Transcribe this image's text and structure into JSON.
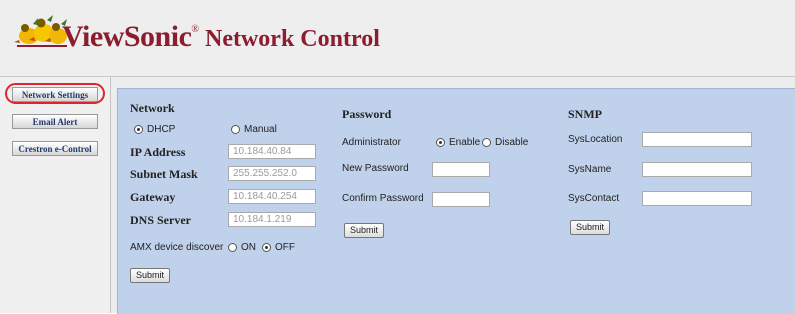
{
  "brand": {
    "name": "ViewSonic",
    "registered": "®",
    "product": "Network Control"
  },
  "sidebar": {
    "items": [
      {
        "label": "Network Settings",
        "active": true
      },
      {
        "label": "Email Alert"
      },
      {
        "label": "Crestron e-Control"
      }
    ]
  },
  "network": {
    "heading": "Network",
    "dhcp_label": "DHCP",
    "manual_label": "Manual",
    "mode_selected": "DHCP",
    "ip_label": "IP Address",
    "ip_value": "10.184.40.84",
    "mask_label": "Subnet Mask",
    "mask_value": "255.255.252.0",
    "gateway_label": "Gateway",
    "gateway_value": "10.184.40.254",
    "dns_label": "DNS Server",
    "dns_value": "10.184.1.219",
    "amx_label": "AMX device discover",
    "on_label": "ON",
    "off_label": "OFF",
    "amx_selected": "OFF",
    "submit_label": "Submit"
  },
  "password": {
    "heading": "Password",
    "admin_label": "Administrator",
    "enable_label": "Enable",
    "disable_label": "Disable",
    "admin_selected": "Enable",
    "new_label": "New Password",
    "new_value": "",
    "confirm_label": "Confirm Password",
    "confirm_value": "",
    "submit_label": "Submit"
  },
  "snmp": {
    "heading": "SNMP",
    "location_label": "SysLocation",
    "location_value": "",
    "name_label": "SysName",
    "name_value": "",
    "contact_label": "SysContact",
    "contact_value": "",
    "submit_label": "Submit"
  },
  "colors": {
    "brand": "#8c1d2e",
    "panel": "#c0d2eb",
    "highlight": "#e0232e",
    "nav_text": "#1f3a6d"
  },
  "icons": {
    "logo": "viewsonic-birds-logo"
  }
}
